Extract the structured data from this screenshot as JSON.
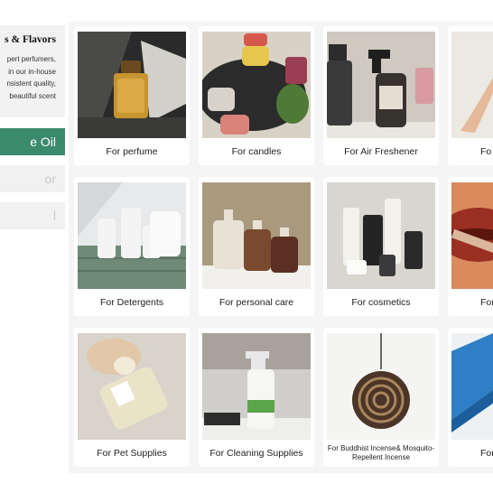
{
  "intro": {
    "title": "s & Flavors",
    "lines": [
      "pert  perfumers,",
      "in  our  in-house",
      "nsistent  quality,",
      "beautiful  scent"
    ]
  },
  "tabs": [
    "e Oil",
    "or",
    "l"
  ],
  "cards": [
    {
      "label": "For perfume"
    },
    {
      "label": "For candles"
    },
    {
      "label": "For Air Freshener"
    },
    {
      "label": "Fo"
    },
    {
      "label": "For Detergents"
    },
    {
      "label": "For personal care"
    },
    {
      "label": "For cosmetics"
    },
    {
      "label": "For c"
    },
    {
      "label": "For Pet Supplies"
    },
    {
      "label": "For Cleaning Supplies"
    },
    {
      "label": "For Buddhist Incense& Mosquito-Repellent Incense"
    },
    {
      "label": "For"
    }
  ],
  "colors": {
    "accent": "#3c8a6e",
    "panel": "#f2f2f2",
    "grid_bg": "#f5f5f5"
  }
}
